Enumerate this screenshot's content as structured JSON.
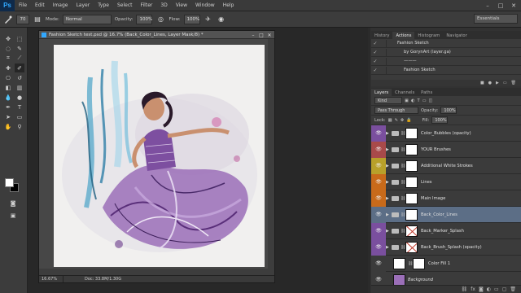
{
  "app": {
    "logo": "Ps"
  },
  "menu": [
    "File",
    "Edit",
    "Image",
    "Layer",
    "Type",
    "Select",
    "Filter",
    "3D",
    "View",
    "Window",
    "Help"
  ],
  "window_controls": [
    "–",
    "□",
    "✕"
  ],
  "options": {
    "brush_size": "70",
    "mode_label": "Mode:",
    "mode_value": "Normal",
    "opacity_label": "Opacity:",
    "opacity_value": "100%",
    "flow_label": "Flow:",
    "flow_value": "100%",
    "workspace": "Essentials"
  },
  "document": {
    "title": "Fashion Sketch test.psd @ 16.7% (Back_Color_Lines, Layer Mask/8) *",
    "zoom": "16.67%",
    "doc_size": "Doc: 33.8M/1.30G"
  },
  "top_panel": {
    "tabs": [
      "History",
      "Actions",
      "Histogram",
      "Navigator"
    ],
    "active_tab": "Actions",
    "rows": [
      {
        "label": "Fashion Sketch",
        "indent": 1
      },
      {
        "label": "by GorynArt (layer.ga)",
        "indent": 2
      },
      {
        "label": "———",
        "indent": 2
      },
      {
        "label": "Fashion Sketch",
        "indent": 2
      }
    ]
  },
  "layers_panel": {
    "tabs": [
      "Layers",
      "Channels",
      "Paths"
    ],
    "active_tab": "Layers",
    "kind_label": "Kind",
    "blend_mode": "Pass Through",
    "opacity_label": "Opacity:",
    "opacity_value": "100%",
    "lock_label": "Lock:",
    "fill_label": "Fill:",
    "fill_value": "100%",
    "layers": [
      {
        "name": "Color_Bubbles (opacity)",
        "color": "#7a4f9e",
        "type": "folder",
        "mask": "plain",
        "selected": false
      },
      {
        "name": "YOUR Brushes",
        "color": "#a84a4a",
        "type": "folder",
        "mask": "plain",
        "selected": false
      },
      {
        "name": "Additional White Strokes",
        "color": "#b8a02a",
        "type": "folder",
        "mask": "plain",
        "selected": false
      },
      {
        "name": "Lines",
        "color": "#c86a1a",
        "type": "folder",
        "mask": "plain",
        "selected": false
      },
      {
        "name": "Main Image",
        "color": "#c86a1a",
        "type": "folder",
        "mask": "plain",
        "selected": false
      },
      {
        "name": "Back_Color_Lines",
        "color": "#5c6e86",
        "type": "folder",
        "mask": "plain",
        "selected": true
      },
      {
        "name": "Back_Marker_Splash",
        "color": "#7a4f9e",
        "type": "folder",
        "mask": "x",
        "selected": false
      },
      {
        "name": "Back_Brush_Splash (opacity)",
        "color": "#7a4f9e",
        "type": "folder",
        "mask": "x",
        "selected": false
      },
      {
        "name": "Color Fill 1",
        "color": "#3b3b3b",
        "type": "fill",
        "mask": "plain",
        "selected": false
      },
      {
        "name": "Background",
        "color": "#3b3b3b",
        "type": "image",
        "mask": "none",
        "selected": false
      }
    ]
  },
  "colors": {
    "accent": "#31a8ff",
    "selected_row": "#5c6e86",
    "dress": "#9b6fb8"
  }
}
